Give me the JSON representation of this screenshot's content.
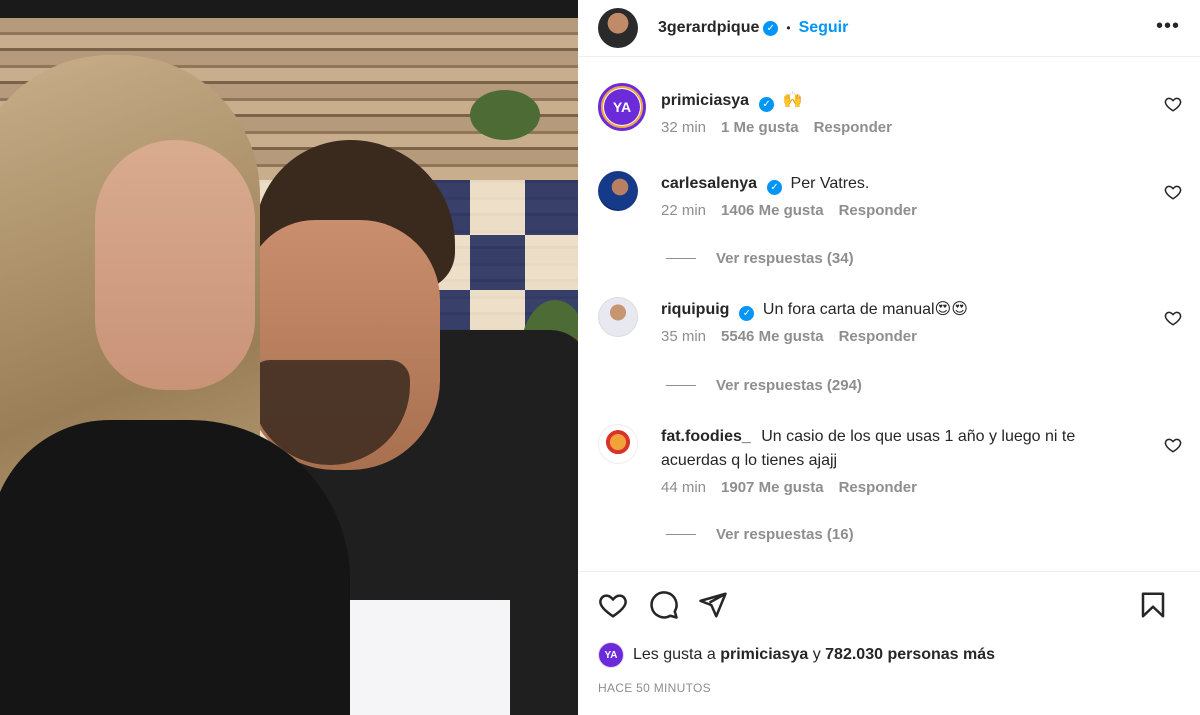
{
  "post": {
    "author": {
      "username": "3gerardpique",
      "verified": true,
      "follow_label": "Seguir",
      "separator": "•"
    },
    "more_icon": "more-horizontal-icon"
  },
  "comments": [
    {
      "username": "primiciasya",
      "avatar_text": "YA",
      "verified": true,
      "text": "🙌",
      "time": "32 min",
      "likes": "1 Me gusta",
      "reply_label": "Responder"
    },
    {
      "username": "carlesalenya",
      "verified": true,
      "text": "Per Vatres.",
      "time": "22 min",
      "likes": "1406 Me gusta",
      "reply_label": "Responder",
      "view_replies": "Ver respuestas (34)"
    },
    {
      "username": "riquipuig",
      "verified": true,
      "text": "Un fora carta de manual😍😍",
      "time": "35 min",
      "likes": "5546 Me gusta",
      "reply_label": "Responder",
      "view_replies": "Ver respuestas (294)"
    },
    {
      "username": "fat.foodies_",
      "verified": false,
      "text": "Un casio de los que usas 1 año y luego ni te acuerdas q lo tienes ajajj",
      "time": "44 min",
      "likes": "1907 Me gusta",
      "reply_label": "Responder",
      "view_replies": "Ver respuestas (16)"
    }
  ],
  "actions": {
    "like_icon": "heart-icon",
    "comment_icon": "comment-icon",
    "share_icon": "send-icon",
    "save_icon": "bookmark-icon"
  },
  "likes": {
    "avatar_text": "YA",
    "prefix": "Les gusta a",
    "user": "primiciasya",
    "connector": "y",
    "others": "782.030 personas más"
  },
  "time_ago": "HACE 50 MINUTOS",
  "colors": {
    "accent": "#0095f6",
    "text": "#262626",
    "muted": "#8e8e8e",
    "primicias_purple": "#6c2bd9"
  }
}
